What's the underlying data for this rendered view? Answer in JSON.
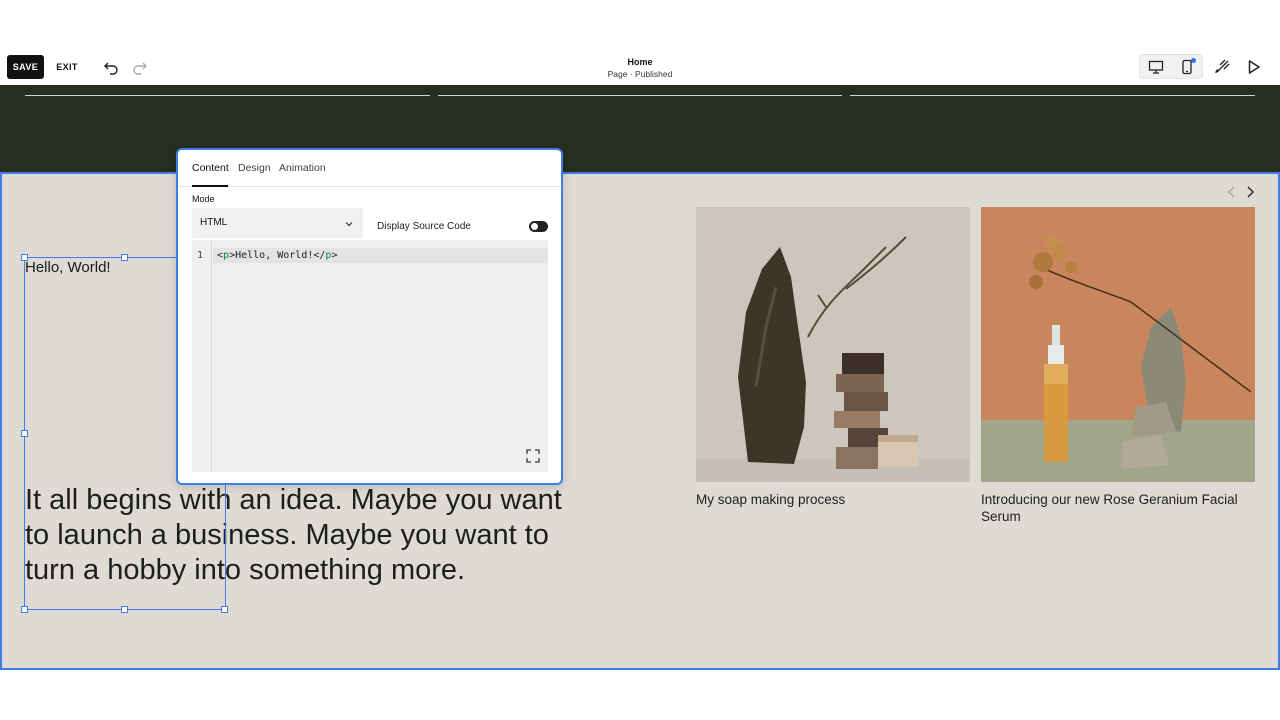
{
  "toolbar": {
    "save_label": "SAVE",
    "exit_label": "EXIT",
    "page_title": "Home",
    "page_status": "Page · Published"
  },
  "section": {
    "hello_text": "Hello, World!",
    "intro_text": "It all begins with an idea. Maybe you want to launch a business. Maybe you want to turn a hobby into something more.",
    "cards": [
      {
        "caption": "My soap making process",
        "image": "soap-stack-with-driftwood"
      },
      {
        "caption": "Introducing our new Rose Geranium Facial Serum",
        "image": "serum-bottle-with-stones"
      }
    ]
  },
  "editor": {
    "tabs": [
      "Content",
      "Design",
      "Animation"
    ],
    "active_tab": "Content",
    "mode_label": "Mode",
    "mode_value": "HTML",
    "display_source_label": "Display Source Code",
    "display_source_enabled": false,
    "code": {
      "line_number": "1",
      "open_bracket": "<",
      "tag": "p",
      "close_bracket": ">",
      "text": "Hello, World!",
      "end_open": "</",
      "end_tag": "p",
      "end_close": ">"
    }
  },
  "colors": {
    "accent": "#3f7ee8",
    "dark_strip": "#262e1f",
    "section_bg": "#dedbd5"
  }
}
